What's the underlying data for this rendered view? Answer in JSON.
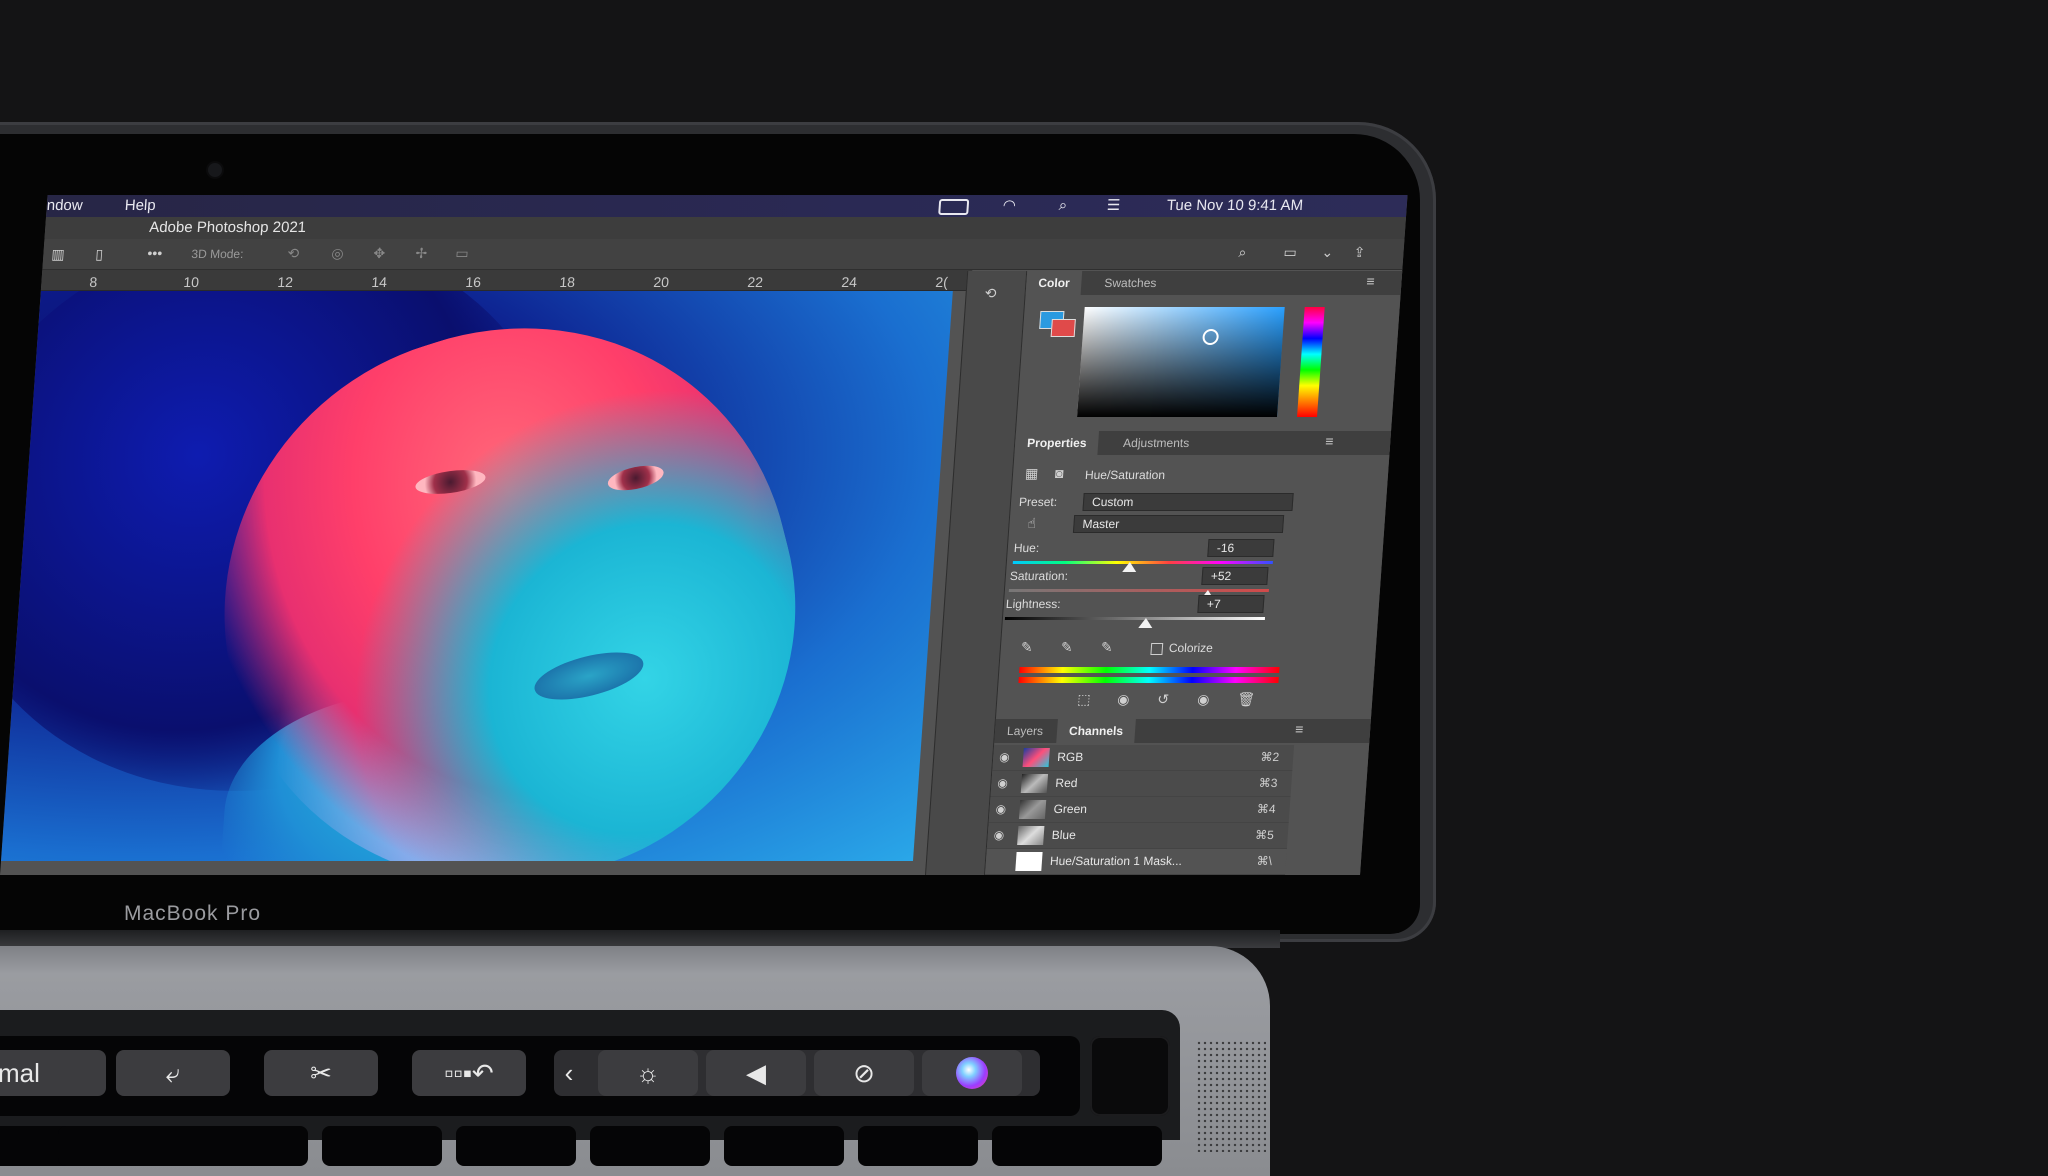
{
  "mac_menubar": {
    "menu_window": "ndow",
    "menu_help": "Help",
    "datetime": "Tue Nov 10   9:41 AM"
  },
  "photoshop": {
    "app_title": "Adobe Photoshop 2021",
    "options": {
      "three_d_mode_label": "3D Mode:"
    },
    "ruler_ticks": [
      "8",
      "10",
      "12",
      "14",
      "16",
      "18",
      "20",
      "22",
      "24",
      "2("
    ],
    "color_panel": {
      "tabs": [
        "Color",
        "Swatches"
      ],
      "active_tab": "Color",
      "foreground_color": "#2a9ae0",
      "background_color": "#e04a4a"
    },
    "properties_panel": {
      "tabs": [
        "Properties",
        "Adjustments"
      ],
      "active_tab": "Properties",
      "adjustment_title": "Hue/Saturation",
      "preset_label": "Preset:",
      "preset_value": "Custom",
      "range_value": "Master",
      "hue_label": "Hue:",
      "hue_value": "-16",
      "saturation_label": "Saturation:",
      "saturation_value": "+52",
      "lightness_label": "Lightness:",
      "lightness_value": "+7",
      "colorize_label": "Colorize",
      "colorize_checked": false
    },
    "layers_panel": {
      "tabs": [
        "Layers",
        "Channels"
      ],
      "active_tab": "Channels",
      "channels": [
        {
          "name": "RGB",
          "shortcut": "⌘2",
          "visible": true
        },
        {
          "name": "Red",
          "shortcut": "⌘3",
          "visible": true
        },
        {
          "name": "Green",
          "shortcut": "⌘4",
          "visible": true
        },
        {
          "name": "Blue",
          "shortcut": "⌘5",
          "visible": true
        },
        {
          "name": "Hue/Saturation 1 Mask...",
          "shortcut": "⌘\\",
          "visible": false
        }
      ]
    }
  },
  "hardware": {
    "brand_label": "MacBook Pro",
    "touchbar": {
      "mode_label": "mal",
      "buttons": [
        "rotate-view-icon",
        "scissors-icon",
        "history-undo-icon",
        "chevron-left-icon",
        "brightness-icon",
        "volume-icon",
        "mute-icon",
        "siri-icon"
      ]
    }
  }
}
